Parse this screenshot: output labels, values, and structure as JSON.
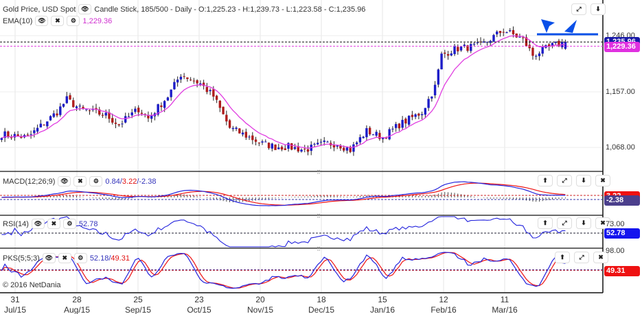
{
  "header": {
    "instrument": "Gold Price, USD Spot",
    "chart_info": "Candle Stick, 185/500 - Daily - O:1,225.23 - H:1,239.73 - L:1,223.58 - C:1,235.96",
    "ema_label": "EMA(10)",
    "ema_value": "1,229.36"
  },
  "macd": {
    "label": "MACD(12;26;9)",
    "v1": "0.84",
    "v2": "3.22",
    "v3": "-2.38",
    "sep": "/"
  },
  "rsi": {
    "label": "RSI(14)",
    "value": "52.78"
  },
  "pks": {
    "label": "PKS(5;5;3)",
    "v1": "52.18",
    "v2": "49.31",
    "sep": "/"
  },
  "axis": {
    "price_labels": [
      "1,246.00",
      "1,157.00",
      "1,068.00"
    ],
    "last_close_badge": "1,235.96",
    "ema_badge": "1,229.36",
    "macd_badge_red": "3.22",
    "macd_badge": "-2.38",
    "rsi_top": "73.00",
    "rsi_badge": "52.78",
    "pks_top": "98.00",
    "pks_badge": "49.31"
  },
  "copyright": "© 2016 NetDania",
  "x_ticks": [
    {
      "day": "31",
      "month": "Jul/15"
    },
    {
      "day": "28",
      "month": "Aug/15"
    },
    {
      "day": "25",
      "month": "Sep/15"
    },
    {
      "day": "23",
      "month": "Oct/15"
    },
    {
      "day": "20",
      "month": "Nov/15"
    },
    {
      "day": "18",
      "month": "Dec/15"
    },
    {
      "day": "15",
      "month": "Jan/16"
    },
    {
      "day": "12",
      "month": "Feb/16"
    },
    {
      "day": "11",
      "month": "Mar/16"
    }
  ],
  "colors": {
    "up": "#1c1cc8",
    "down": "#b01c1c",
    "ema": "#e03ce0",
    "blue": "#2222dd",
    "red": "#ee1111",
    "macd_badge": "#4b3f8c",
    "annotation": "#0a50e8"
  },
  "chart_data": {
    "type": "candlestick",
    "title": "Gold Price, USD Spot",
    "total_bars": 185,
    "ylim": [
      1030,
      1290
    ],
    "close_keypoints": [
      [
        0,
        1090
      ],
      [
        8,
        1085
      ],
      [
        17,
        1125
      ],
      [
        20,
        1145
      ],
      [
        24,
        1130
      ],
      [
        32,
        1120
      ],
      [
        36,
        1105
      ],
      [
        42,
        1130
      ],
      [
        45,
        1115
      ],
      [
        51,
        1150
      ],
      [
        55,
        1185
      ],
      [
        61,
        1170
      ],
      [
        65,
        1150
      ],
      [
        70,
        1100
      ],
      [
        76,
        1085
      ],
      [
        80,
        1075
      ],
      [
        84,
        1070
      ],
      [
        88,
        1070
      ],
      [
        93,
        1065
      ],
      [
        99,
        1075
      ],
      [
        103,
        1075
      ],
      [
        107,
        1065
      ],
      [
        112,
        1095
      ],
      [
        117,
        1085
      ],
      [
        122,
        1105
      ],
      [
        129,
        1125
      ],
      [
        133,
        1165
      ],
      [
        135,
        1215
      ],
      [
        139,
        1225
      ],
      [
        147,
        1230
      ],
      [
        154,
        1255
      ],
      [
        160,
        1240
      ],
      [
        163,
        1215
      ],
      [
        169,
        1230
      ],
      [
        173,
        1236
      ]
    ],
    "last": {
      "open": 1225.23,
      "high": 1239.73,
      "low": 1223.58,
      "close": 1235.96
    },
    "ema10_last": 1229.36,
    "resistance_line": 1248
  }
}
